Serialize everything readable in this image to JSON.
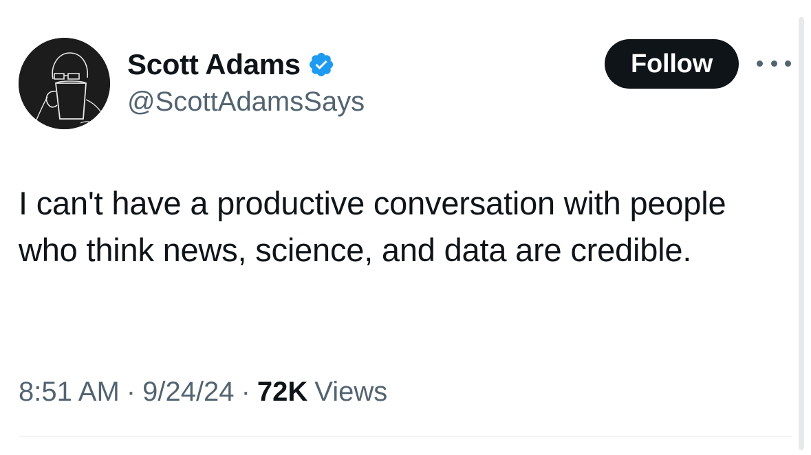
{
  "author": {
    "display_name": "Scott Adams",
    "handle": "@ScottAdamsSays",
    "verified": true,
    "verified_color": "#1d9bf0",
    "avatar_icon": "sketch-man-drinking-mug-avatar"
  },
  "actions": {
    "follow_label": "Follow",
    "more_icon": "more-horizontal-icon"
  },
  "tweet": {
    "text": "I can't have a productive conversation with people who think news, science, and data are credible."
  },
  "meta": {
    "time": "8:51 AM",
    "separator": "·",
    "date": "9/24/24",
    "views_count": "72K",
    "views_label": "Views"
  },
  "colors": {
    "text_primary": "#0f1419",
    "text_secondary": "#536471",
    "follow_bg": "#0f1419",
    "follow_text": "#ffffff"
  }
}
